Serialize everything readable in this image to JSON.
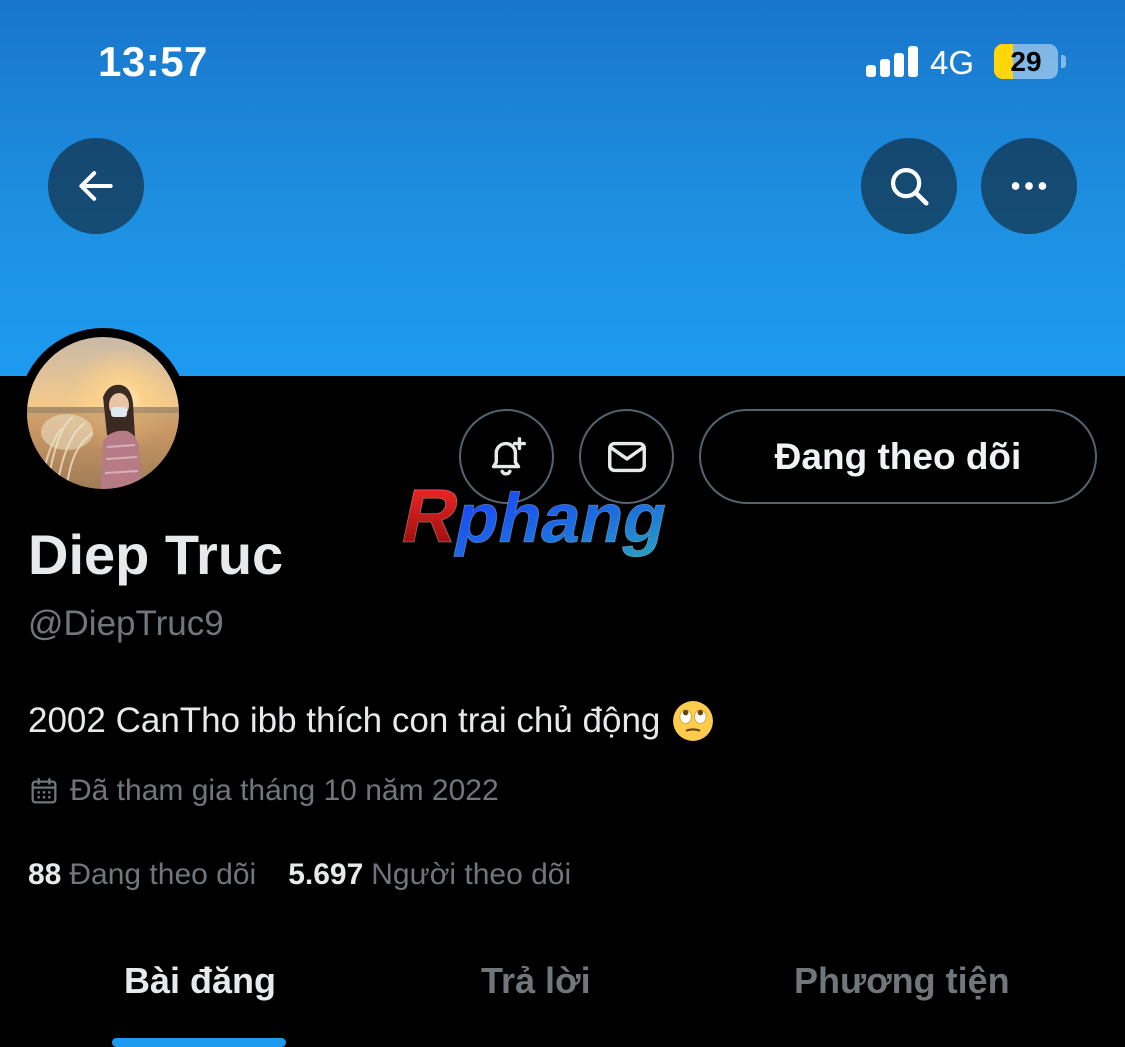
{
  "status_bar": {
    "time": "13:57",
    "network": "4G",
    "battery_level": "29",
    "battery_fraction": 0.29,
    "signal_bars": 4
  },
  "nav": {
    "back_icon": "arrow-left-icon",
    "search_icon": "search-icon",
    "more_icon": "more-horizontal-icon"
  },
  "banner": {
    "color": "#1d9bf0"
  },
  "actions": {
    "notify_icon": "bell-plus-icon",
    "message_icon": "envelope-icon",
    "following_label": "Đang theo dõi"
  },
  "watermark": {
    "text": "Rphang"
  },
  "profile": {
    "display_name": "Diep Truc",
    "handle": "@DiepTruc9",
    "bio": "2002 CanTho ibb thích con trai chủ động",
    "bio_emoji": "face-with-rolling-eyes",
    "joined": "Đã tham gia tháng 10 năm 2022",
    "following_count": "88",
    "following_label": "Đang theo dõi",
    "followers_count": "5.697",
    "followers_label": "Người theo dõi"
  },
  "tabs": [
    {
      "label": "Bài đăng",
      "active": true
    },
    {
      "label": "Trả lời",
      "active": false
    },
    {
      "label": "Phương tiện",
      "active": false
    }
  ],
  "colors": {
    "accent": "#1d9bf0",
    "muted_text": "#71767b",
    "primary_text": "#e7e9ea",
    "background": "#000000"
  }
}
